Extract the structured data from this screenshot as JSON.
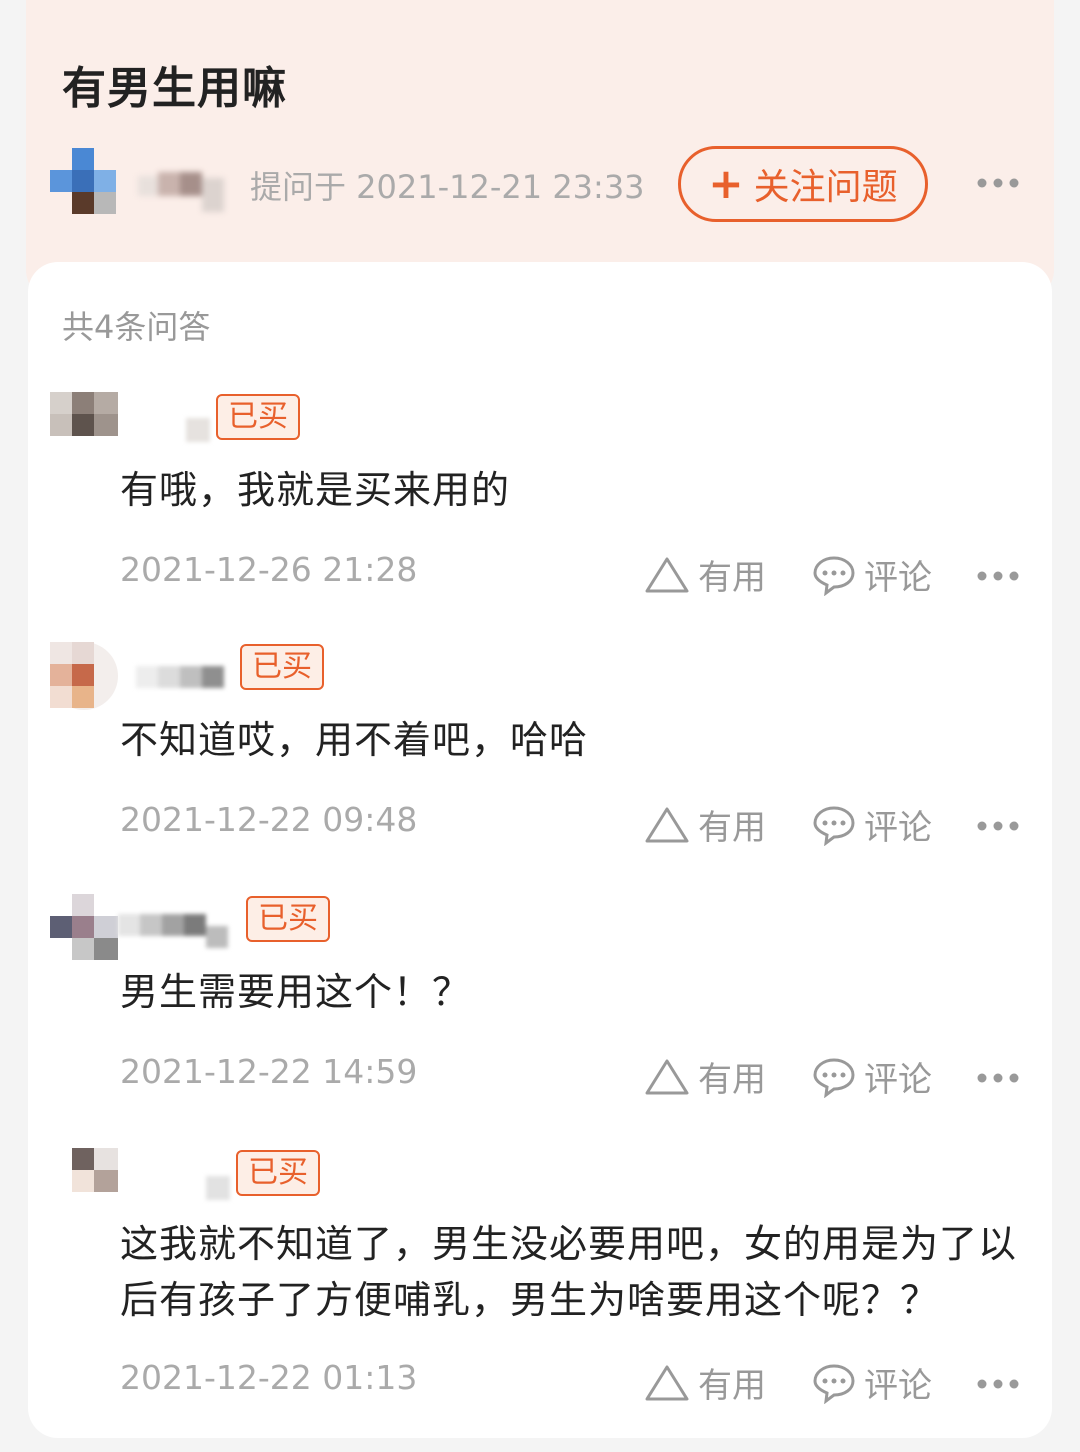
{
  "question": {
    "title": "有男生用嘛",
    "asked_at": "提问于 2021-12-21 23:33",
    "follow_label": "关注问题",
    "follow_icon": "plus-icon"
  },
  "answers_count_label": "共4条问答",
  "answers": [
    {
      "badge": "已买",
      "text": "有哦，我就是买来用的",
      "date": "2021-12-26 21:28",
      "useful_label": "有用",
      "comment_label": "评论"
    },
    {
      "badge": "已买",
      "text": "不知道哎，用不着吧，哈哈",
      "date": "2021-12-22 09:48",
      "useful_label": "有用",
      "comment_label": "评论"
    },
    {
      "badge": "已买",
      "text": "男生需要用这个！？",
      "date": "2021-12-22 14:59",
      "useful_label": "有用",
      "comment_label": "评论"
    },
    {
      "badge": "已买",
      "text": "这我就不知道了，男生没必要用吧，女的用是为了以后有孩子了方便哺乳，男生为啥要用这个呢？？",
      "date": "2021-12-22 01:13",
      "useful_label": "有用",
      "comment_label": "评论"
    }
  ],
  "colors": {
    "accent": "#e8602c",
    "header_bg": "#fbeee9",
    "muted_text": "#aaaaaa"
  }
}
